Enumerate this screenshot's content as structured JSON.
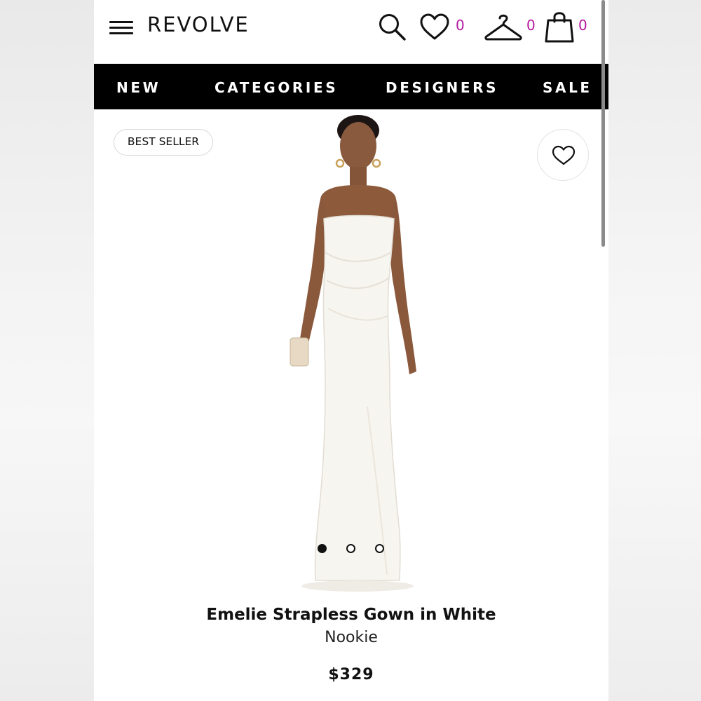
{
  "header": {
    "logo": "REVOLVE",
    "icons": [
      "menu-icon",
      "search-icon",
      "heart-icon",
      "hanger-icon",
      "shopping-bag-icon"
    ],
    "wishlist_count": "0",
    "hanger_count": "0",
    "bag_count": "0",
    "count_color": "#b5179e"
  },
  "nav": {
    "items": [
      {
        "label": "NEW"
      },
      {
        "label": "CATEGORIES"
      },
      {
        "label": "DESIGNERS"
      },
      {
        "label": "SALE"
      }
    ]
  },
  "product": {
    "badge": "BEST SELLER",
    "name": "Emelie Strapless Gown in White",
    "brand": "Nookie",
    "price": "$329",
    "image_icon": "white-strapless-gown-photo",
    "carousel": {
      "total": 3,
      "active": 1
    }
  }
}
